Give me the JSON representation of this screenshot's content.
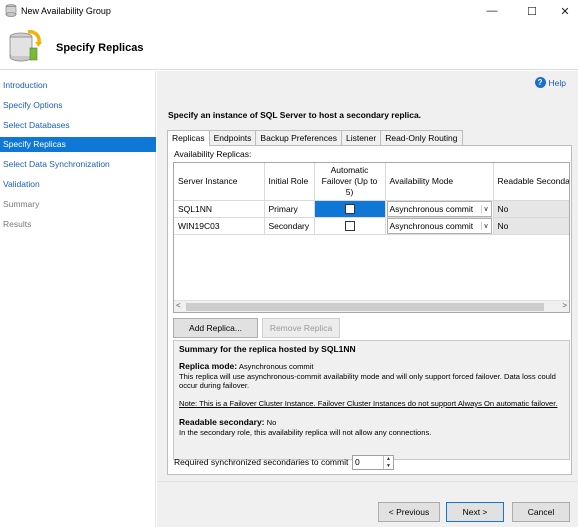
{
  "window": {
    "title": "New Availability Group",
    "minimize": "—",
    "maximize": "☐",
    "close": "✕"
  },
  "header": {
    "title": "Specify Replicas"
  },
  "nav": {
    "items": [
      {
        "label": "Introduction",
        "state": "link"
      },
      {
        "label": "Specify Options",
        "state": "link"
      },
      {
        "label": "Select Databases",
        "state": "link"
      },
      {
        "label": "Specify Replicas",
        "state": "active"
      },
      {
        "label": "Select Data Synchronization",
        "state": "link"
      },
      {
        "label": "Validation",
        "state": "link"
      },
      {
        "label": "Summary",
        "state": "disabled"
      },
      {
        "label": "Results",
        "state": "disabled"
      }
    ]
  },
  "help": {
    "label": "Help",
    "icon": "?"
  },
  "instruction": "Specify an instance of SQL Server to host a secondary replica.",
  "tabs": [
    "Replicas",
    "Endpoints",
    "Backup Preferences",
    "Listener",
    "Read-Only Routing"
  ],
  "replicas": {
    "section_label": "Availability Replicas:",
    "columns": {
      "server": "Server Instance",
      "role": "Initial Role",
      "failover": "Automatic Failover (Up to 5)",
      "mode": "Availability Mode",
      "readable": "Readable Secondar"
    },
    "rows": [
      {
        "server": "SQL1NN",
        "role": "Primary",
        "failover_checked": false,
        "mode": "Asynchronous commit",
        "readable": "No"
      },
      {
        "server": "WIN19C03",
        "role": "Secondary",
        "failover_checked": false,
        "mode": "Asynchronous commit",
        "readable": "No"
      }
    ],
    "scroll_left": "<",
    "scroll_right": ">",
    "combo_arrow": "∨"
  },
  "buttons": {
    "add_replica": "Add Replica...",
    "remove_replica": "Remove Replica",
    "previous": "< Previous",
    "next": "Next >",
    "cancel": "Cancel"
  },
  "summary": {
    "title": "Summary for the replica hosted by SQL1NN",
    "replica_mode_label": "Replica mode:",
    "replica_mode_value": "Asynchronous commit",
    "replica_mode_desc": "This replica will use asynchronous-commit availability mode and will only support forced failover. Data loss could occur during failover.",
    "note": "Note: This is a Failover Cluster Instance. Failover Cluster Instances do not support Always On automatic failover.",
    "readable_label": "Readable secondary:",
    "readable_value": "No",
    "readable_desc": "In the secondary role, this availability replica will not allow any connections."
  },
  "required": {
    "label": "Required synchronized secondaries to commit",
    "value": "0",
    "up": "▲",
    "down": "▼"
  },
  "colors": {
    "accent": "#0f78d7",
    "link": "#1a5fb4"
  }
}
